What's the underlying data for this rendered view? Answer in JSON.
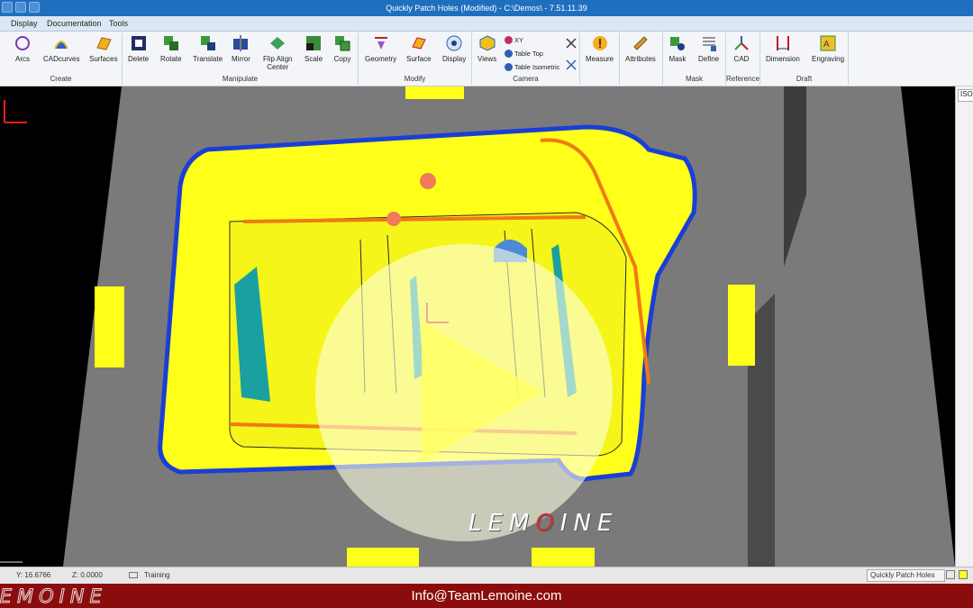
{
  "window": {
    "title": "Quickly Patch Holes (Modified) - C:\\Demos\\ - 7.51.11.39"
  },
  "menu": {
    "tabs": [
      "Display",
      "Documentation",
      "Tools"
    ]
  },
  "ribbon": {
    "groups": {
      "create": "Create",
      "manipulate": "Manipulate",
      "modify": "Modify",
      "camera": "Camera",
      "mask": "Mask",
      "reference": "Reference",
      "draft": "Draft"
    },
    "buttons": {
      "arcs": "Arcs",
      "cadcurves": "CADcurves",
      "surfaces": "Surfaces",
      "delete": "Delete",
      "rotate": "Rotate",
      "translate": "Translate",
      "mirror": "Mirror",
      "flip_align": "Flip Align",
      "flip_align_sub": "Center",
      "scale": "Scale",
      "copy": "Copy",
      "geometry": "Geometry",
      "surface": "Surface",
      "display": "Display",
      "views": "Views",
      "xy": "XY",
      "table_top": "Table Top",
      "table_isometric": "Table Isometric",
      "measure": "Measure",
      "attributes": "Attributes",
      "mask": "Mask",
      "define": "Define",
      "cad": "CAD",
      "dimension": "Dimension",
      "engraving": "Engraving"
    }
  },
  "viewport": {
    "logo_left": "LEM",
    "logo_accent": "O",
    "logo_right": "INE"
  },
  "side_panel": {
    "tab": "ISO"
  },
  "status": {
    "y": "Y: 16.6766",
    "z": "Z: 0.0000",
    "mode": "Training",
    "file": "Quickly Patch Holes"
  },
  "footer": {
    "logo": "LEMOINE",
    "email": "Info@TeamLemoine.com"
  },
  "colors": {
    "part_yellow": "#ffff1a",
    "edge_blue": "#1a3fd6",
    "edge_orange": "#f07a14",
    "plate_gray": "#7a7a7a",
    "banner_red": "#8b0c0c"
  }
}
